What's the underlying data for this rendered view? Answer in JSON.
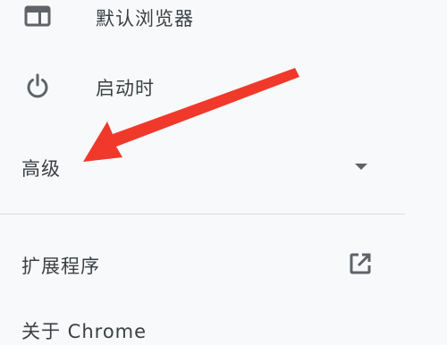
{
  "settings_nav": {
    "items": [
      {
        "label": "默认浏览器",
        "icon": "browser-window-icon"
      },
      {
        "label": "启动时",
        "icon": "power-icon"
      }
    ],
    "advanced": {
      "label": "高级",
      "icon": "caret-down-icon"
    },
    "extensions": {
      "label": "扩展程序",
      "icon": "open-in-new-icon"
    },
    "about": {
      "label": "关于 Chrome"
    }
  },
  "annotation": {
    "color": "#f0392b",
    "icon": "red-arrow"
  },
  "colors": {
    "background": "#f8f9fa",
    "text": "#3c4043",
    "icon": "#5f6368",
    "divider": "#dadce0"
  }
}
